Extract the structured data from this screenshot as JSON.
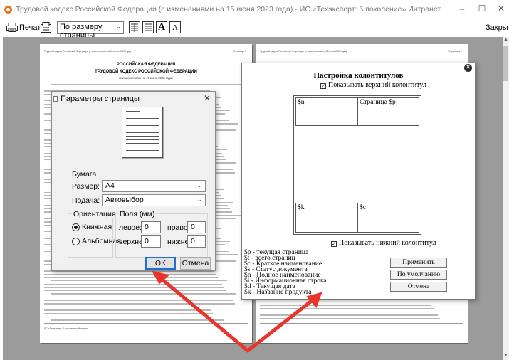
{
  "window": {
    "title": "Трудовой кодекс Российской Федерации (с изменениями на 15 июня 2023 года) - ИС «Техэксперт: 6 поколение» Интранет",
    "minimize": "–",
    "maximize": "☐",
    "close": "✕"
  },
  "toolbar": {
    "print_label": "Печать",
    "zoom_value": "По размеру страницы",
    "font_a_large": "A",
    "font_a_small": "A",
    "close_label": "Закрыть"
  },
  "preview": {
    "left_page": {
      "header_left": "Трудовой кодекс Российской Федерации (с изменениями на 15 июня 2023 года)",
      "header_right": "Страница 1",
      "heading1": "РОССИЙСКАЯ ФЕДЕРАЦИЯ",
      "heading2": "ТРУДОВОЙ КОДЕКС РОССИЙСКОЙ ФЕДЕРАЦИИ",
      "heading3": "(с изменениями на 15 июня 2023 года)",
      "footer": "ИС «Техэксперт: 6 поколение» Интранет"
    },
    "right_page": {
      "header_left": "Трудовой кодекс Российской Федерации (с изменениями на 15 июня 2023 года)",
      "header_right": "Страница 2"
    }
  },
  "page_setup": {
    "title": "Параметры страницы",
    "close": "✕",
    "paper_group": "Бумага",
    "size_label": "Размер:",
    "size_value": "A4",
    "feed_label": "Подача:",
    "feed_value": "Автовыбор",
    "orientation_group": "Ориентация",
    "portrait": "Книжная",
    "landscape": "Альбомная",
    "orientation_selected": "portrait",
    "margins_group": "Поля (мм)",
    "left_label": "левое:",
    "left_value": "0",
    "right_label": "правое:",
    "right_value": "0",
    "top_label": "верхнее:",
    "top_value": "0",
    "bottom_label": "нижнее:",
    "bottom_value": "0",
    "ok": "OK",
    "cancel": "Отмена"
  },
  "header_footer": {
    "title": "Настройка колонтитулов",
    "show_top": "Показывать верхний колонтитул",
    "show_bottom": "Показывать нижний колонтитул",
    "top_left_cell": "$n",
    "top_right_cell": "Страница $p",
    "bottom_left_cell": "$k",
    "bottom_right_cell": "$c",
    "legend": [
      "$p - текущая страница",
      "$t - всего страниц",
      "$с - Краткое наименование",
      "$s - Статус документа",
      "$n - Полное наименование",
      "$i - Информационная строка",
      "$d - Текущая дата",
      "$k - Название продукта"
    ],
    "apply": "Применить",
    "default": "По умолчанию",
    "cancel": "Отмена"
  },
  "colors": {
    "accent": "#1e6fd0",
    "arrow": "#e8342a",
    "preview_bg": "#9b9b9b"
  }
}
